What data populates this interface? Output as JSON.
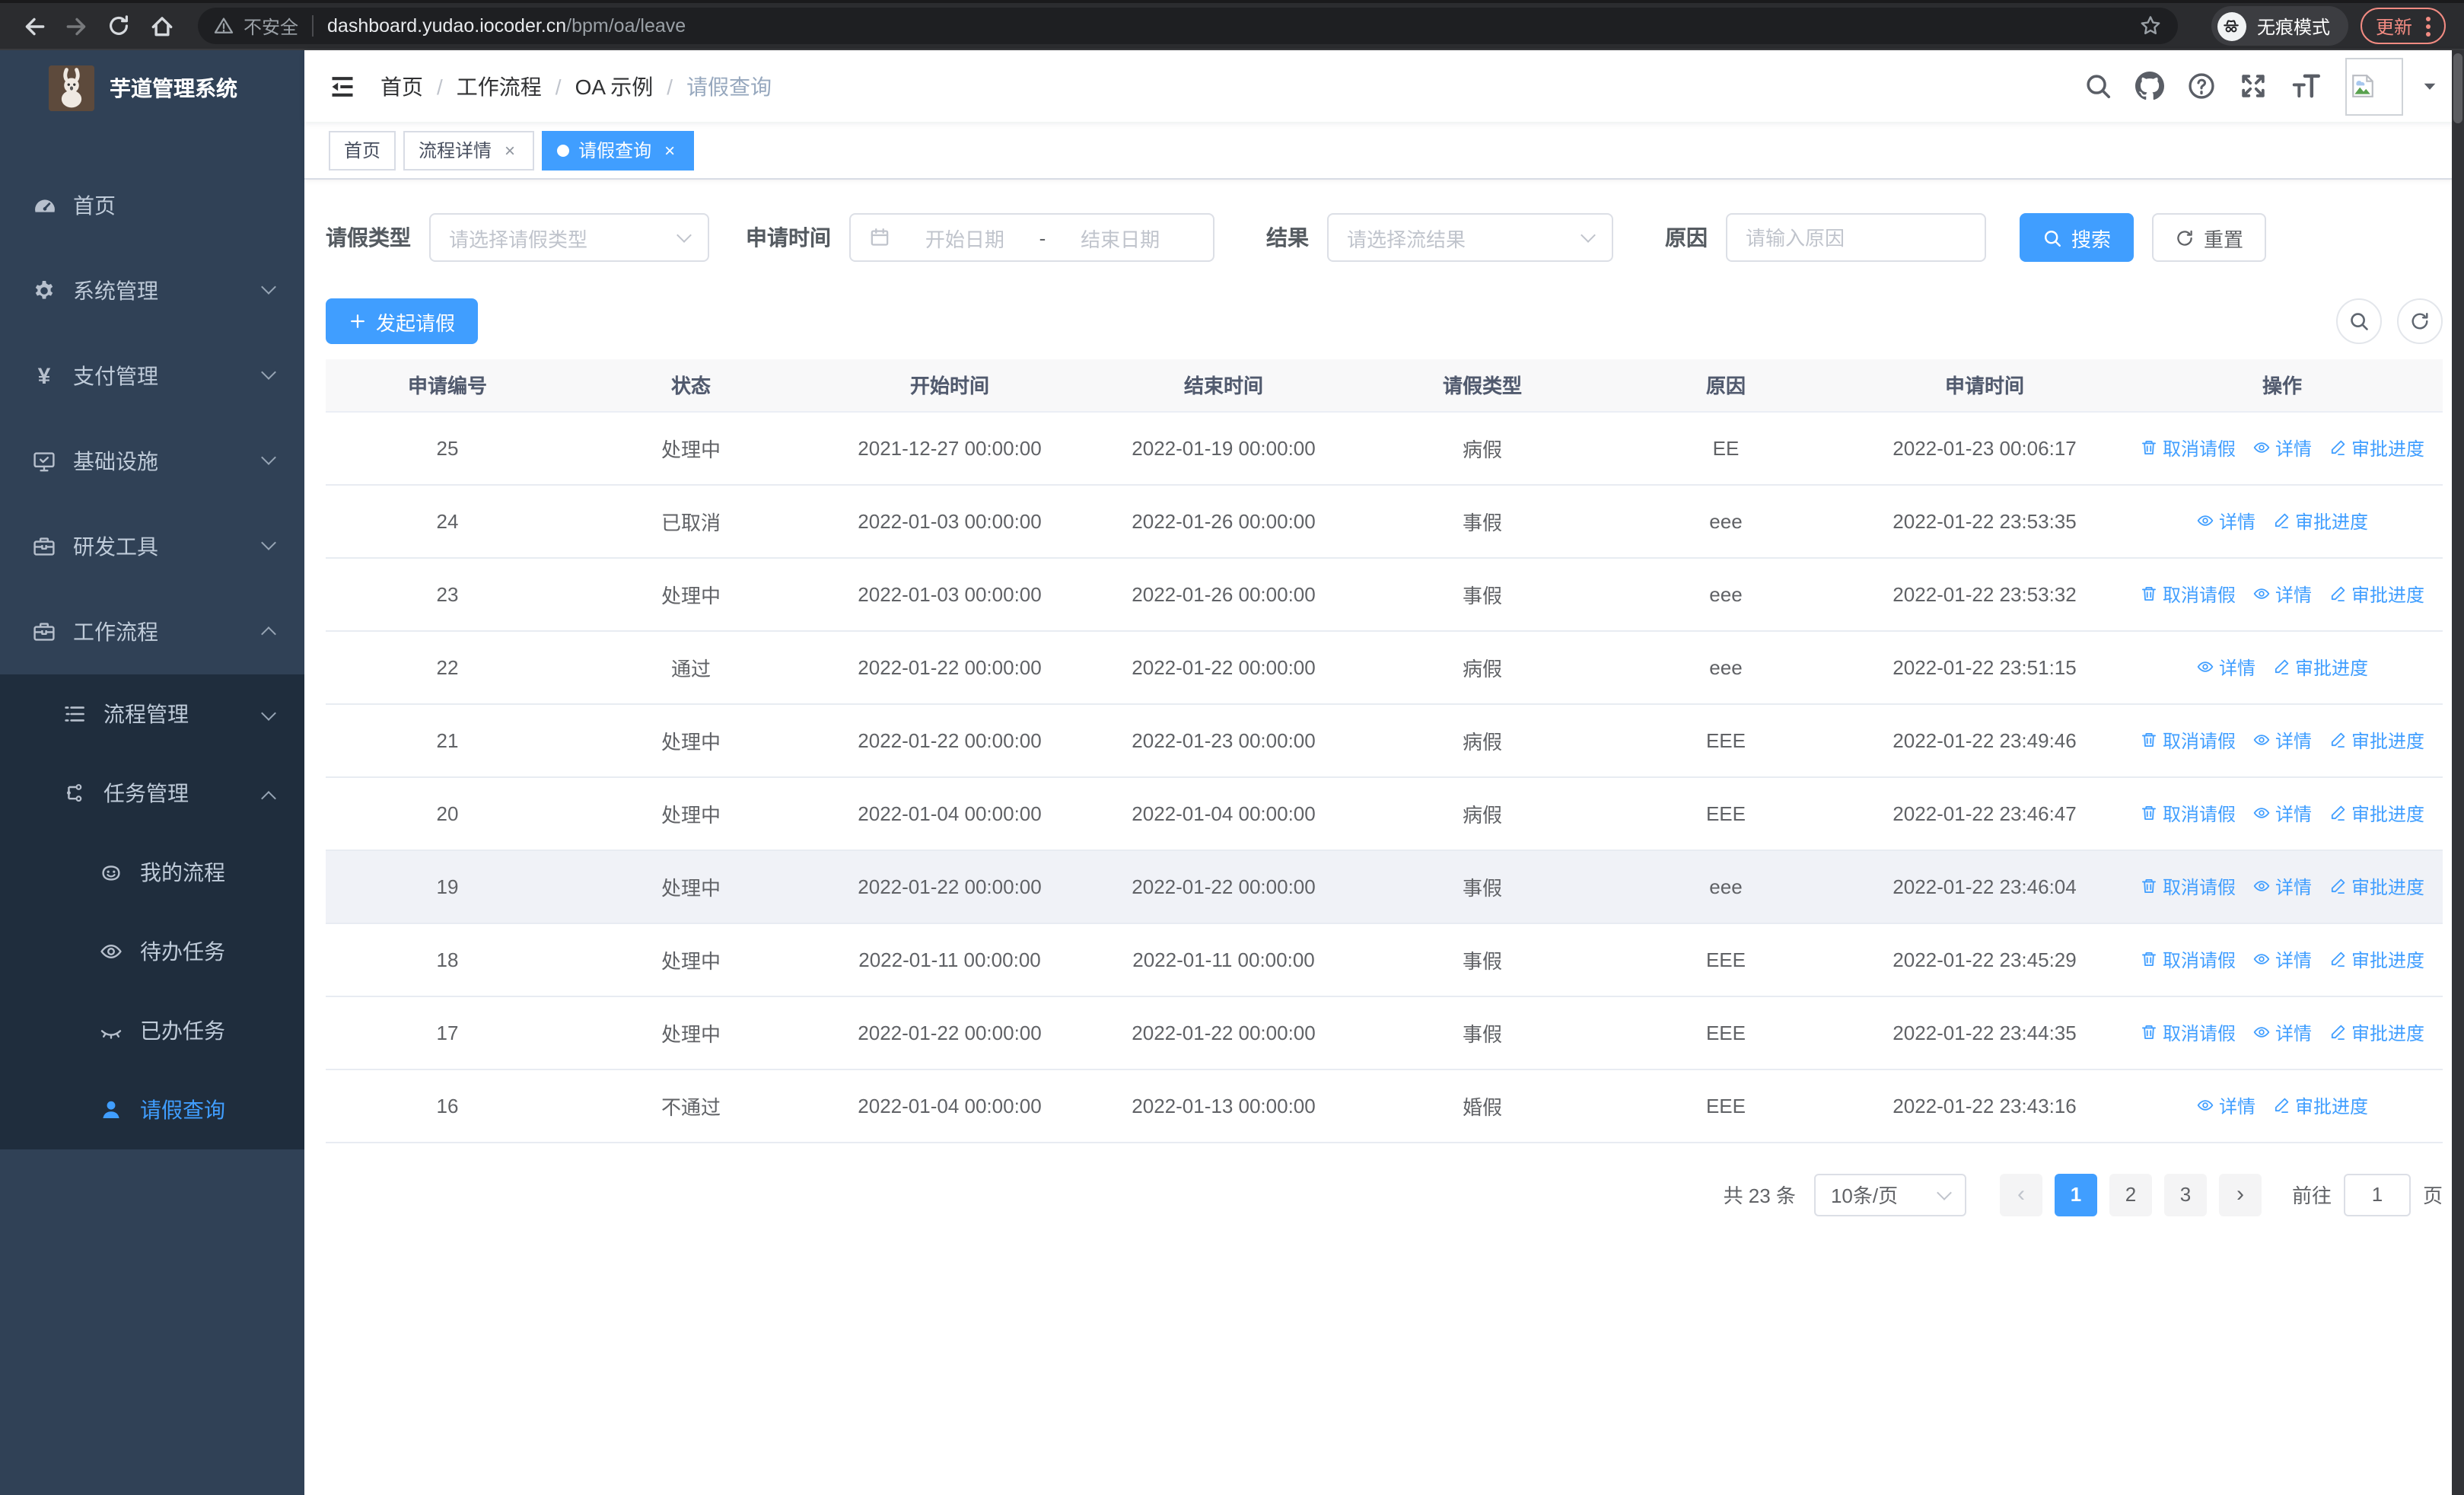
{
  "browser": {
    "security_label": "不安全",
    "url_host": "dashboard.yudao.iocoder.cn",
    "url_path": "/bpm/oa/leave",
    "incognito_label": "无痕模式",
    "update_label": "更新"
  },
  "sidebar": {
    "title": "芋道管理系统",
    "menu": [
      {
        "label": "首页"
      },
      {
        "label": "系统管理"
      },
      {
        "label": "支付管理"
      },
      {
        "label": "基础设施"
      },
      {
        "label": "研发工具"
      },
      {
        "label": "工作流程"
      }
    ],
    "submenu": [
      {
        "label": "流程管理"
      },
      {
        "label": "任务管理"
      }
    ],
    "tasks": [
      {
        "label": "我的流程"
      },
      {
        "label": "待办任务"
      },
      {
        "label": "已办任务"
      },
      {
        "label": "请假查询"
      }
    ]
  },
  "navbar": {
    "breadcrumb": [
      "首页",
      "工作流程",
      "OA 示例",
      "请假查询"
    ]
  },
  "tabs": [
    {
      "label": "首页"
    },
    {
      "label": "流程详情"
    },
    {
      "label": "请假查询"
    }
  ],
  "filters": {
    "leave_type_label": "请假类型",
    "leave_type_placeholder": "请选择请假类型",
    "apply_time_label": "申请时间",
    "start_date_placeholder": "开始日期",
    "range_separator": "-",
    "end_date_placeholder": "结束日期",
    "result_label": "结果",
    "result_placeholder": "请选择流结果",
    "reason_label": "原因",
    "reason_placeholder": "请输入原因",
    "search_label": "搜索",
    "reset_label": "重置"
  },
  "toolbar": {
    "create_label": "发起请假"
  },
  "table": {
    "columns": [
      "申请编号",
      "状态",
      "开始时间",
      "结束时间",
      "请假类型",
      "原因",
      "申请时间",
      "操作"
    ],
    "action_labels": {
      "cancel": "取消请假",
      "detail": "详情",
      "progress": "审批进度"
    },
    "rows": [
      {
        "id": "25",
        "status": "处理中",
        "start": "2021-12-27 00:00:00",
        "end": "2022-01-19 00:00:00",
        "type": "病假",
        "reason": "EE",
        "applied": "2022-01-23 00:06:17",
        "can_cancel": true,
        "highlight": false
      },
      {
        "id": "24",
        "status": "已取消",
        "start": "2022-01-03 00:00:00",
        "end": "2022-01-26 00:00:00",
        "type": "事假",
        "reason": "eee",
        "applied": "2022-01-22 23:53:35",
        "can_cancel": false,
        "highlight": false
      },
      {
        "id": "23",
        "status": "处理中",
        "start": "2022-01-03 00:00:00",
        "end": "2022-01-26 00:00:00",
        "type": "事假",
        "reason": "eee",
        "applied": "2022-01-22 23:53:32",
        "can_cancel": true,
        "highlight": false
      },
      {
        "id": "22",
        "status": "通过",
        "start": "2022-01-22 00:00:00",
        "end": "2022-01-22 00:00:00",
        "type": "病假",
        "reason": "eee",
        "applied": "2022-01-22 23:51:15",
        "can_cancel": false,
        "highlight": false
      },
      {
        "id": "21",
        "status": "处理中",
        "start": "2022-01-22 00:00:00",
        "end": "2022-01-23 00:00:00",
        "type": "病假",
        "reason": "EEE",
        "applied": "2022-01-22 23:49:46",
        "can_cancel": true,
        "highlight": false
      },
      {
        "id": "20",
        "status": "处理中",
        "start": "2022-01-04 00:00:00",
        "end": "2022-01-04 00:00:00",
        "type": "病假",
        "reason": "EEE",
        "applied": "2022-01-22 23:46:47",
        "can_cancel": true,
        "highlight": false
      },
      {
        "id": "19",
        "status": "处理中",
        "start": "2022-01-22 00:00:00",
        "end": "2022-01-22 00:00:00",
        "type": "事假",
        "reason": "eee",
        "applied": "2022-01-22 23:46:04",
        "can_cancel": true,
        "highlight": true
      },
      {
        "id": "18",
        "status": "处理中",
        "start": "2022-01-11 00:00:00",
        "end": "2022-01-11 00:00:00",
        "type": "事假",
        "reason": "EEE",
        "applied": "2022-01-22 23:45:29",
        "can_cancel": true,
        "highlight": false
      },
      {
        "id": "17",
        "status": "处理中",
        "start": "2022-01-22 00:00:00",
        "end": "2022-01-22 00:00:00",
        "type": "事假",
        "reason": "EEE",
        "applied": "2022-01-22 23:44:35",
        "can_cancel": true,
        "highlight": false
      },
      {
        "id": "16",
        "status": "不通过",
        "start": "2022-01-04 00:00:00",
        "end": "2022-01-13 00:00:00",
        "type": "婚假",
        "reason": "EEE",
        "applied": "2022-01-22 23:43:16",
        "can_cancel": false,
        "highlight": false
      }
    ]
  },
  "pagination": {
    "total_label": "共 23 条",
    "page_size_label": "10条/页",
    "pages": [
      "1",
      "2",
      "3"
    ],
    "active_page": "1",
    "goto_label": "前往",
    "goto_value": "1",
    "goto_suffix": "页"
  },
  "colors": {
    "primary": "#409eff",
    "sidebar_bg": "#304156",
    "submenu_bg": "#1f2d3d",
    "update_accent": "#f28b82"
  }
}
